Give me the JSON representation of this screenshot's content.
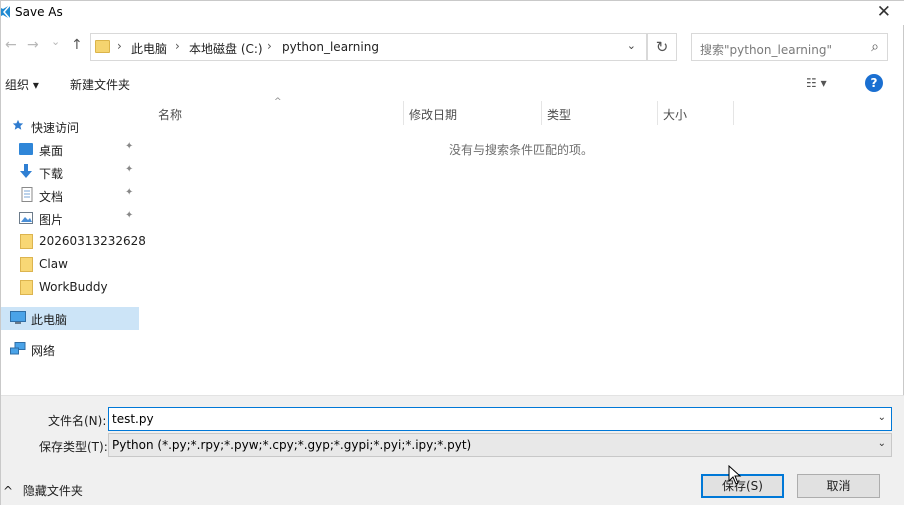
{
  "window": {
    "title": "Save As",
    "close_glyph": "✕"
  },
  "nav": {
    "back_glyph": "←",
    "forward_glyph": "→",
    "recent_glyph": "⌄",
    "up_glyph": "↑",
    "breadcrumb": [
      "此电脑",
      "本地磁盘 (C:)",
      "python_learning"
    ],
    "crumb_sep": "›",
    "dropdown_glyph": "⌄",
    "refresh_glyph": "↻",
    "search_placeholder": "搜索\"python_learning\"",
    "search_glyph": "⌕"
  },
  "toolbar": {
    "organize_label": "组织 ▾",
    "new_folder_label": "新建文件夹",
    "view_glyph": "☷ ▾",
    "help_glyph": "?"
  },
  "sidebar": {
    "quick_access": "快速访问",
    "items": [
      {
        "label": "桌面",
        "icon": "desktop-icon",
        "pinned": true
      },
      {
        "label": "下载",
        "icon": "download-icon",
        "pinned": true
      },
      {
        "label": "文档",
        "icon": "document-icon",
        "pinned": true
      },
      {
        "label": "图片",
        "icon": "picture-icon",
        "pinned": true
      },
      {
        "label": "20260313232628",
        "icon": "folder-icon",
        "pinned": false
      },
      {
        "label": "Claw",
        "icon": "folder-icon",
        "pinned": false
      },
      {
        "label": "WorkBuddy",
        "icon": "folder-icon",
        "pinned": false
      }
    ],
    "this_pc": "此电脑",
    "network": "网络",
    "pin_glyph": "📌"
  },
  "content": {
    "columns": [
      "名称",
      "修改日期",
      "类型",
      "大小"
    ],
    "sort_glyph": "^",
    "empty_message": "没有与搜索条件匹配的项。"
  },
  "form": {
    "filename_label": "文件名(N):",
    "filename_value": "test.py",
    "filetype_label": "保存类型(T):",
    "filetype_value": "Python (*.py;*.rpy;*.pyw;*.cpy;*.gyp;*.gypi;*.pyi;*.ipy;*.pyt)",
    "dropdown_glyph": "⌄",
    "hide_folders_label": "隐藏文件夹",
    "hide_glyph": "^",
    "save_label": "保存(S)",
    "cancel_label": "取消"
  },
  "colors": {
    "accent": "#0078d7",
    "selection": "#cce4f7",
    "folder": "#f5d46f"
  }
}
